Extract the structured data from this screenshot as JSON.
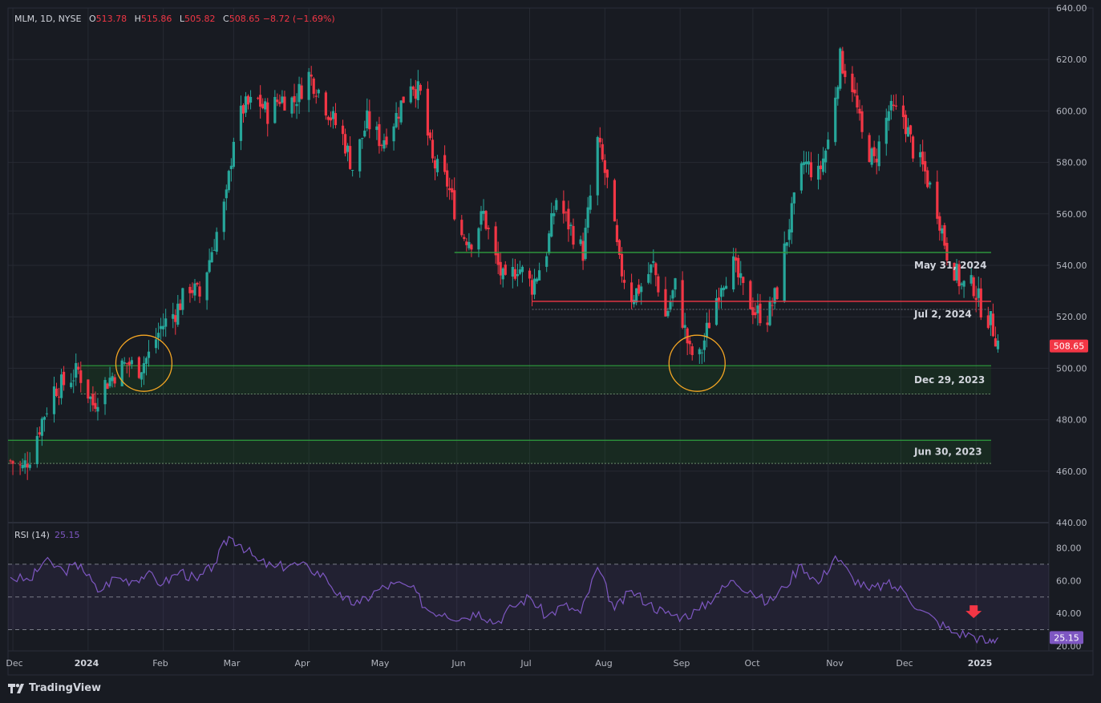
{
  "header": {
    "symbol": "MLM, 1D, NYSE",
    "open_label": "O",
    "open": "513.78",
    "high_label": "H",
    "high": "515.86",
    "low_label": "L",
    "low": "505.82",
    "close_label": "C",
    "close": "508.65",
    "change": "−8.72 (−1.69%)"
  },
  "rsi": {
    "label": "RSI (14)",
    "value": "25.15"
  },
  "brand": "TradingView",
  "colors": {
    "background": "#181b22",
    "grid": "#262a33",
    "up": "#26a69a",
    "down": "#f23645",
    "rsi_line": "#7e57c2",
    "zone_green": "#1b5e20",
    "level_red": "#f23645",
    "circle": "#f5a623"
  },
  "chart_data": [
    {
      "type": "candlestick",
      "title": "MLM, 1D, NYSE",
      "ylim": [
        440,
        640
      ],
      "y_ticks": [
        "640.00",
        "620.00",
        "600.00",
        "580.00",
        "560.00",
        "540.00",
        "520.00",
        "500.00",
        "480.00",
        "460.00",
        "440.00"
      ],
      "x_ticks": [
        "Dec",
        "2024",
        "Feb",
        "Mar",
        "Apr",
        "May",
        "Jun",
        "Jul",
        "Aug",
        "Sep",
        "Oct",
        "Nov",
        "Dec",
        "2025"
      ],
      "x_range": [
        "2023-11-29",
        "2025-01-31"
      ],
      "last_price": "508.65",
      "close_path": [
        [
          "2023-11-30",
          464
        ],
        [
          "2023-12-05",
          461
        ],
        [
          "2023-12-08",
          466
        ],
        [
          "2023-12-13",
          480
        ],
        [
          "2023-12-18",
          492
        ],
        [
          "2023-12-22",
          494
        ],
        [
          "2023-12-28",
          499
        ],
        [
          "2024-01-03",
          486
        ],
        [
          "2024-01-08",
          494
        ],
        [
          "2024-01-12",
          498
        ],
        [
          "2024-01-17",
          502
        ],
        [
          "2024-01-22",
          500
        ],
        [
          "2024-01-26",
          505
        ],
        [
          "2024-01-31",
          516
        ],
        [
          "2024-02-06",
          522
        ],
        [
          "2024-02-12",
          532
        ],
        [
          "2024-02-16",
          528
        ],
        [
          "2024-02-21",
          546
        ],
        [
          "2024-02-27",
          566
        ],
        [
          "2024-03-01",
          590
        ],
        [
          "2024-03-05",
          601
        ],
        [
          "2024-03-11",
          604
        ],
        [
          "2024-03-15",
          599
        ],
        [
          "2024-03-20",
          605
        ],
        [
          "2024-03-26",
          604
        ],
        [
          "2024-04-01",
          614
        ],
        [
          "2024-04-05",
          608
        ],
        [
          "2024-04-10",
          598
        ],
        [
          "2024-04-15",
          590
        ],
        [
          "2024-04-19",
          578
        ],
        [
          "2024-04-25",
          596
        ],
        [
          "2024-05-01",
          588
        ],
        [
          "2024-05-07",
          598
        ],
        [
          "2024-05-13",
          612
        ],
        [
          "2024-05-17",
          606
        ],
        [
          "2024-05-22",
          580
        ],
        [
          "2024-05-28",
          572
        ],
        [
          "2024-06-03",
          552
        ],
        [
          "2024-06-07",
          550
        ],
        [
          "2024-06-12",
          560
        ],
        [
          "2024-06-17",
          542
        ],
        [
          "2024-06-21",
          532
        ],
        [
          "2024-06-26",
          540
        ],
        [
          "2024-07-02",
          532
        ],
        [
          "2024-07-08",
          546
        ],
        [
          "2024-07-12",
          566
        ],
        [
          "2024-07-17",
          556
        ],
        [
          "2024-07-23",
          545
        ],
        [
          "2024-07-29",
          588
        ],
        [
          "2024-08-02",
          572
        ],
        [
          "2024-08-07",
          540
        ],
        [
          "2024-08-12",
          528
        ],
        [
          "2024-08-16",
          532
        ],
        [
          "2024-08-21",
          540
        ],
        [
          "2024-08-26",
          520
        ],
        [
          "2024-08-30",
          532
        ],
        [
          "2024-09-05",
          506
        ],
        [
          "2024-09-09",
          504
        ],
        [
          "2024-09-13",
          518
        ],
        [
          "2024-09-18",
          534
        ],
        [
          "2024-09-23",
          540
        ],
        [
          "2024-09-27",
          530
        ],
        [
          "2024-10-02",
          522
        ],
        [
          "2024-10-07",
          520
        ],
        [
          "2024-10-11",
          530
        ],
        [
          "2024-10-16",
          556
        ],
        [
          "2024-10-22",
          580
        ],
        [
          "2024-10-28",
          575
        ],
        [
          "2024-11-01",
          588
        ],
        [
          "2024-11-06",
          620
        ],
        [
          "2024-11-11",
          610
        ],
        [
          "2024-11-15",
          590
        ],
        [
          "2024-11-20",
          580
        ],
        [
          "2024-11-26",
          600
        ],
        [
          "2024-12-02",
          598
        ],
        [
          "2024-12-06",
          585
        ],
        [
          "2024-12-11",
          576
        ],
        [
          "2024-12-16",
          562
        ],
        [
          "2024-12-20",
          545
        ],
        [
          "2024-12-26",
          532
        ],
        [
          "2024-12-31",
          532
        ],
        [
          "2025-01-03",
          524
        ],
        [
          "2025-01-07",
          518
        ],
        [
          "2025-01-10",
          510
        ]
      ],
      "levels": [
        {
          "label": "May 31, 2024",
          "kind": "line",
          "price": 545,
          "start": "2024-05-31",
          "color": "up"
        },
        {
          "label": "Jul 2, 2024",
          "kind": "line",
          "price": 526,
          "start": "2024-07-02",
          "color": "down"
        },
        {
          "label": "Dec 29, 2023",
          "kind": "zone",
          "top": 501,
          "bottom": 490,
          "start": "2023-12-29"
        },
        {
          "label": "Jun 30, 2023",
          "kind": "zone",
          "top": 472,
          "bottom": 463,
          "start": "2023-11-29"
        }
      ],
      "circles": [
        {
          "date": "2024-01-24",
          "price": 501
        },
        {
          "date": "2024-09-08",
          "price": 501
        }
      ]
    },
    {
      "type": "line",
      "title": "RSI (14)",
      "ylim": [
        17,
        94
      ],
      "y_ticks": [
        "80.00",
        "60.00",
        "40.00",
        "20.00"
      ],
      "bands": [
        30,
        50,
        70
      ],
      "last_value": "25.15",
      "signal_arrow": {
        "date": "2024-12-31",
        "value": 38
      },
      "rsi_path": [
        [
          "2023-11-30",
          62
        ],
        [
          "2023-12-08",
          60
        ],
        [
          "2023-12-14",
          72
        ],
        [
          "2023-12-22",
          66
        ],
        [
          "2023-12-29",
          70
        ],
        [
          "2024-01-05",
          53
        ],
        [
          "2024-01-12",
          62
        ],
        [
          "2024-01-19",
          60
        ],
        [
          "2024-01-25",
          64
        ],
        [
          "2024-02-01",
          58
        ],
        [
          "2024-02-08",
          66
        ],
        [
          "2024-02-15",
          60
        ],
        [
          "2024-02-22",
          70
        ],
        [
          "2024-02-28",
          87
        ],
        [
          "2024-03-04",
          82
        ],
        [
          "2024-03-11",
          72
        ],
        [
          "2024-03-18",
          68
        ],
        [
          "2024-03-25",
          70
        ],
        [
          "2024-04-01",
          68
        ],
        [
          "2024-04-08",
          62
        ],
        [
          "2024-04-15",
          48
        ],
        [
          "2024-04-22",
          46
        ],
        [
          "2024-04-29",
          54
        ],
        [
          "2024-05-06",
          58
        ],
        [
          "2024-05-13",
          56
        ],
        [
          "2024-05-20",
          42
        ],
        [
          "2024-05-27",
          40
        ],
        [
          "2024-06-03",
          37
        ],
        [
          "2024-06-10",
          41
        ],
        [
          "2024-06-17",
          34
        ],
        [
          "2024-06-24",
          44
        ],
        [
          "2024-07-01",
          50
        ],
        [
          "2024-07-08",
          38
        ],
        [
          "2024-07-15",
          45
        ],
        [
          "2024-07-22",
          40
        ],
        [
          "2024-07-29",
          68
        ],
        [
          "2024-08-05",
          42
        ],
        [
          "2024-08-12",
          54
        ],
        [
          "2024-08-19",
          46
        ],
        [
          "2024-08-26",
          40
        ],
        [
          "2024-09-02",
          38
        ],
        [
          "2024-09-09",
          42
        ],
        [
          "2024-09-16",
          52
        ],
        [
          "2024-09-23",
          60
        ],
        [
          "2024-09-30",
          54
        ],
        [
          "2024-10-07",
          46
        ],
        [
          "2024-10-14",
          56
        ],
        [
          "2024-10-21",
          70
        ],
        [
          "2024-10-28",
          58
        ],
        [
          "2024-11-04",
          75
        ],
        [
          "2024-11-11",
          62
        ],
        [
          "2024-11-18",
          54
        ],
        [
          "2024-11-25",
          58
        ],
        [
          "2024-12-02",
          54
        ],
        [
          "2024-12-09",
          42
        ],
        [
          "2024-12-16",
          35
        ],
        [
          "2024-12-23",
          28
        ],
        [
          "2024-12-30",
          27
        ],
        [
          "2025-01-06",
          22
        ],
        [
          "2025-01-10",
          25.15
        ]
      ]
    }
  ]
}
